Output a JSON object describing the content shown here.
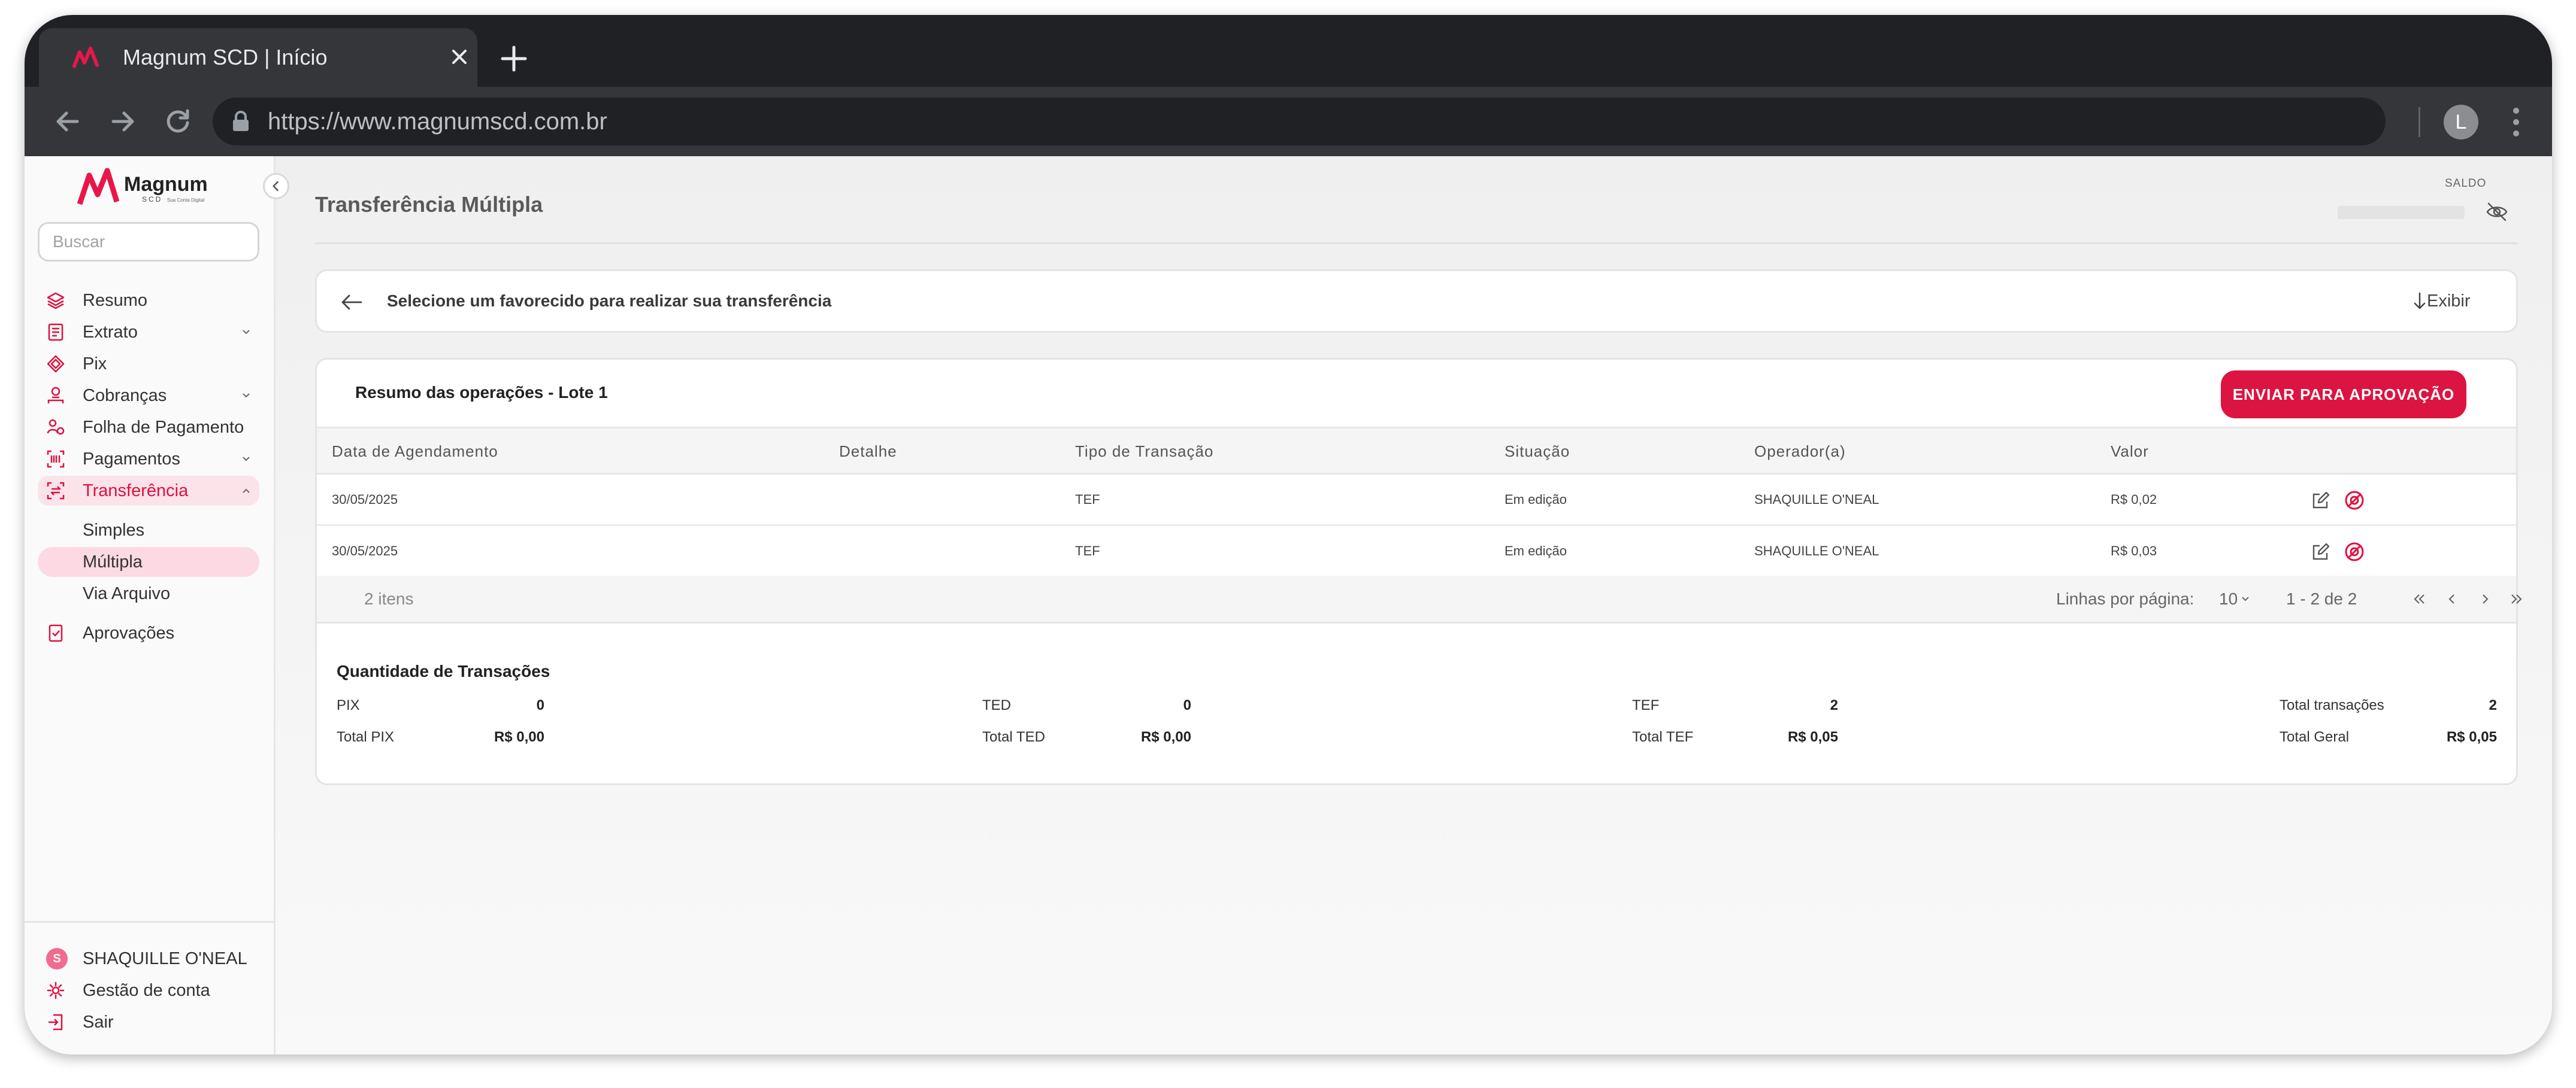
{
  "browser": {
    "tab_title": "Magnum SCD  |  Início",
    "url": "https://www.magnumscd.com.br",
    "profile_initial": "L"
  },
  "sidebar": {
    "logo_text": "Magnum",
    "logo_sub": "SCD",
    "logo_tagline": "Sua Conta Digital",
    "search_placeholder": "Buscar",
    "items": [
      {
        "label": "Resumo",
        "icon": "layers-icon"
      },
      {
        "label": "Extrato",
        "icon": "receipt-icon"
      },
      {
        "label": "Pix",
        "icon": "pix-icon"
      },
      {
        "label": "Cobranças",
        "icon": "billing-icon"
      },
      {
        "label": "Folha de Pagamento",
        "icon": "payroll-icon"
      },
      {
        "label": "Pagamentos",
        "icon": "barcode-icon"
      },
      {
        "label": "Transferência",
        "icon": "transfer-icon"
      }
    ],
    "subitems": [
      {
        "label": "Simples"
      },
      {
        "label": "Múltipla"
      },
      {
        "label": "Via Arquivo"
      }
    ],
    "approvals_label": "Aprovações",
    "user_initial": "S",
    "user_name": "SHAQUILLE O'NEAL",
    "account_label": "Gestão de conta",
    "logout_label": "Sair"
  },
  "header": {
    "title": "Transferência Múltipla",
    "saldo_label": "SALDO"
  },
  "select_card": {
    "text": "Selecione um favorecido para realizar sua transferência",
    "show_label": "Exibir"
  },
  "summary": {
    "title": "Resumo das operações - Lote 1",
    "send_button": "ENVIAR PARA APROVAÇÃO",
    "columns": [
      "Data de Agendamento",
      "Detalhe",
      "Tipo de Transação",
      "Situação",
      "Operador(a)",
      "Valor"
    ],
    "rows": [
      {
        "date": "30/05/2025",
        "detail": "",
        "type": "TEF",
        "status": "Em edição",
        "operator": "SHAQUILLE O'NEAL",
        "value": "R$ 0,02"
      },
      {
        "date": "30/05/2025",
        "detail": "",
        "type": "TEF",
        "status": "Em edição",
        "operator": "SHAQUILLE O'NEAL",
        "value": "R$ 0,03"
      }
    ],
    "items_count": "2 itens",
    "rows_per_page_label": "Linhas por página:",
    "rows_per_page": "10",
    "page_range": "1 - 2 de 2"
  },
  "totals": {
    "title": "Quantidade de Transações",
    "pix_label": "PIX",
    "pix_count": "0",
    "ted_label": "TED",
    "ted_count": "0",
    "tef_label": "TEF",
    "tef_count": "2",
    "total_tx_label": "Total transações",
    "total_tx": "2",
    "total_pix_label": "Total PIX",
    "total_pix": "R$ 0,00",
    "total_ted_label": "Total TED",
    "total_ted": "R$ 0,00",
    "total_tef_label": "Total TEF",
    "total_tef": "R$ 0,05",
    "total_geral_label": "Total Geral",
    "total_geral": "R$ 0,05"
  },
  "colors": {
    "brand": "#dc1442",
    "active_bg": "#fce3ea",
    "chrome_dark": "#202124",
    "chrome_toolbar": "#35363a"
  }
}
